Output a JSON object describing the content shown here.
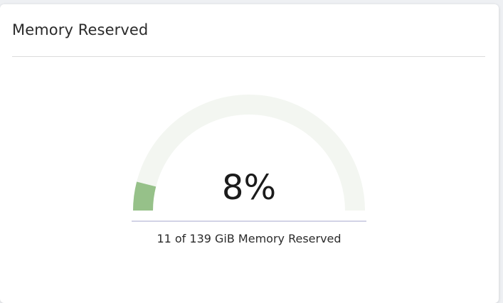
{
  "card": {
    "title": "Memory Reserved"
  },
  "gauge": {
    "percent_label": "8%",
    "fraction": 0.08,
    "caption": "11 of 139 GiB Memory Reserved",
    "fill_color": "#96c189",
    "track_color": "#f3f6f1"
  }
}
